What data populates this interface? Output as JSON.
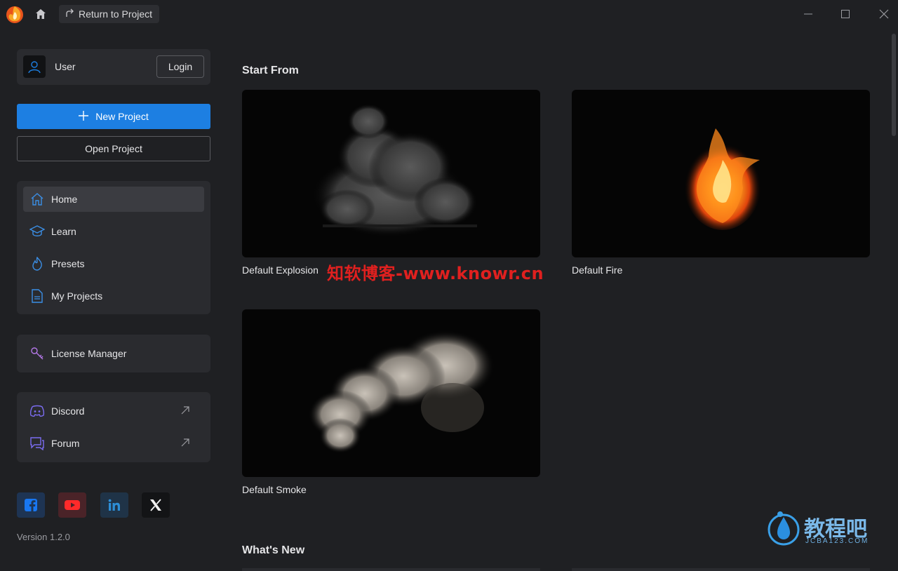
{
  "titlebar": {
    "return_label": "Return to Project"
  },
  "user": {
    "name": "User",
    "login_label": "Login"
  },
  "actions": {
    "new_project": "New Project",
    "open_project": "Open Project"
  },
  "nav": {
    "items": [
      {
        "label": "Home",
        "icon": "home-icon",
        "active": true
      },
      {
        "label": "Learn",
        "icon": "graduation-cap-icon"
      },
      {
        "label": "Presets",
        "icon": "flame-icon"
      },
      {
        "label": "My Projects",
        "icon": "document-icon"
      }
    ]
  },
  "license": {
    "label": "License Manager"
  },
  "links": {
    "items": [
      {
        "label": "Discord",
        "icon": "discord-icon"
      },
      {
        "label": "Forum",
        "icon": "chat-icon"
      }
    ]
  },
  "social": [
    "facebook-icon",
    "youtube-icon",
    "linkedin-icon",
    "x-icon"
  ],
  "version": "Version 1.2.0",
  "main": {
    "start_from_title": "Start From",
    "whats_new_title": "What's New",
    "templates": [
      {
        "label": "Default Explosion"
      },
      {
        "label": "Default Fire"
      },
      {
        "label": "Default Smoke"
      }
    ]
  },
  "watermarks": {
    "red": "知软博客-www.knowr.cn",
    "blue_main": "教程吧",
    "blue_sub": "JCBA123.COM"
  },
  "colors": {
    "accent": "#1d7fe2",
    "background": "#1f2023",
    "card": "#2a2b2f"
  }
}
